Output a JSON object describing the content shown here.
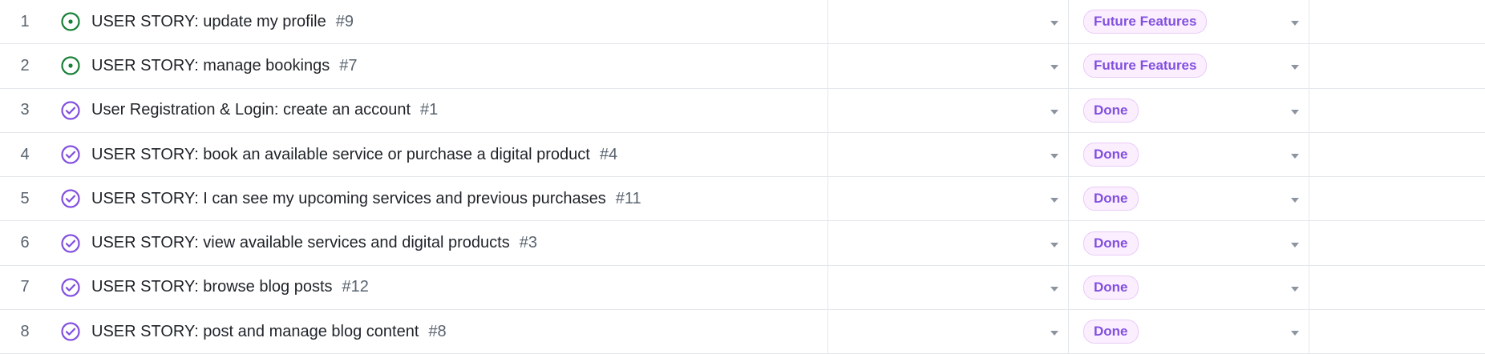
{
  "colors": {
    "open_icon": "#1a7f37",
    "done_icon": "#8250df",
    "badge_text": "#8250df",
    "badge_bg": "#fbefff",
    "badge_border": "#e8c9f7"
  },
  "rows": [
    {
      "num": "1",
      "icon": "open-issue-icon",
      "title": "USER STORY: update my profile",
      "issue": "#9",
      "status": "Future Features"
    },
    {
      "num": "2",
      "icon": "open-issue-icon",
      "title": "USER STORY: manage bookings",
      "issue": "#7",
      "status": "Future Features"
    },
    {
      "num": "3",
      "icon": "completed-issue-icon",
      "title": "User Registration & Login: create an account",
      "issue": "#1",
      "status": "Done"
    },
    {
      "num": "4",
      "icon": "completed-issue-icon",
      "title": "USER STORY: book an available service or purchase a digital product",
      "issue": "#4",
      "status": "Done"
    },
    {
      "num": "5",
      "icon": "completed-issue-icon",
      "title": "USER STORY: I can see my upcoming services and previous purchases",
      "issue": "#11",
      "status": "Done"
    },
    {
      "num": "6",
      "icon": "completed-issue-icon",
      "title": "USER STORY: view available services and digital products",
      "issue": "#3",
      "status": "Done"
    },
    {
      "num": "7",
      "icon": "completed-issue-icon",
      "title": "USER STORY: browse blog posts",
      "issue": "#12",
      "status": "Done"
    },
    {
      "num": "8",
      "icon": "completed-issue-icon",
      "title": "USER STORY: post and manage blog content",
      "issue": "#8",
      "status": "Done"
    }
  ]
}
